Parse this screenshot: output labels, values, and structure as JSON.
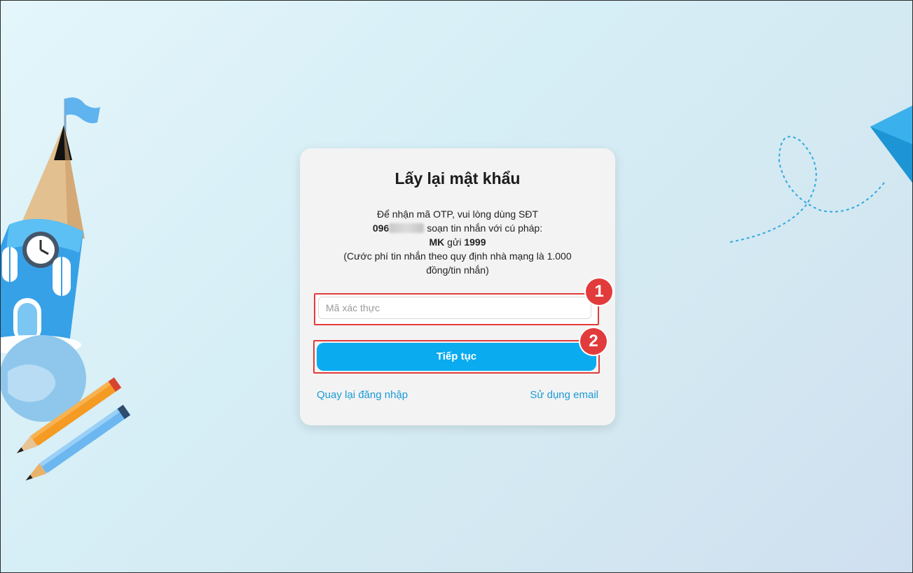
{
  "page": {
    "title": "Lấy lại mật khẩu"
  },
  "info": {
    "line1": "Để nhận mã OTP, vui lòng dùng SĐT",
    "phone_prefix": "096",
    "line2_suffix": "soạn tin nhắn với cú pháp:",
    "syntax_code": "MK",
    "syntax_word": "gửi",
    "syntax_number": "1999",
    "fee_note": "(Cước phí tin nhắn theo quy định nhà mạng là 1.000 đồng/tin nhắn)"
  },
  "form": {
    "code_input": {
      "placeholder": "Mã xác thực",
      "value": ""
    },
    "submit_label": "Tiếp tục"
  },
  "links": {
    "back_to_login": "Quay lại đăng nhập",
    "use_email": "Sử dụng email"
  },
  "annotations": {
    "marker1": "1",
    "marker2": "2"
  },
  "colors": {
    "primary": "#0aabef",
    "link": "#1a9bd7",
    "annotation": "#e23b3b",
    "card_background": "#f3f3f3"
  }
}
